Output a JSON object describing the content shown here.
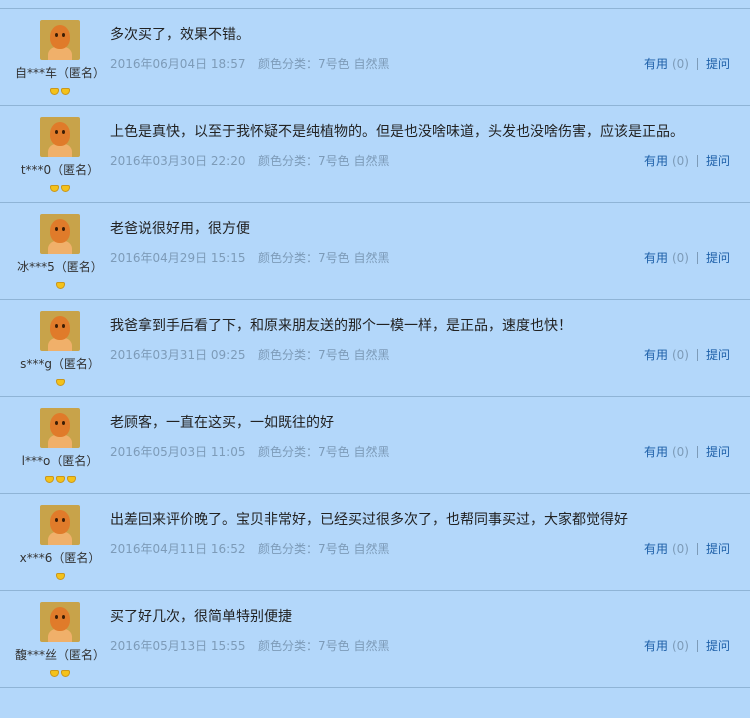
{
  "reviews": [
    {
      "user": "自***车（匿名）",
      "gems": 2,
      "content": "多次买了，效果不错。",
      "date": "2016年06月04日 18:57",
      "spec": "颜色分类：7号色 自然黑",
      "useful_label": "有用",
      "useful_count": "(0)",
      "ask_label": "提问"
    },
    {
      "user": "t***0（匿名）",
      "gems": 2,
      "content": "上色是真快，以至于我怀疑不是纯植物的。但是也没啥味道，头发也没啥伤害，应该是正品。",
      "date": "2016年03月30日 22:20",
      "spec": "颜色分类：7号色 自然黑",
      "useful_label": "有用",
      "useful_count": "(0)",
      "ask_label": "提问"
    },
    {
      "user": "冰***5（匿名）",
      "gems": 1,
      "content": "老爸说很好用，很方便",
      "date": "2016年04月29日 15:15",
      "spec": "颜色分类：7号色 自然黑",
      "useful_label": "有用",
      "useful_count": "(0)",
      "ask_label": "提问"
    },
    {
      "user": "s***g（匿名）",
      "gems": 1,
      "content": "我爸拿到手后看了下，和原来朋友送的那个一模一样，是正品，速度也快！",
      "date": "2016年03月31日 09:25",
      "spec": "颜色分类：7号色 自然黑",
      "useful_label": "有用",
      "useful_count": "(0)",
      "ask_label": "提问"
    },
    {
      "user": "l***o（匿名）",
      "gems": 3,
      "content": "老顾客，一直在这买，一如既往的好",
      "date": "2016年05月03日 11:05",
      "spec": "颜色分类：7号色 自然黑",
      "useful_label": "有用",
      "useful_count": "(0)",
      "ask_label": "提问"
    },
    {
      "user": "x***6（匿名）",
      "gems": 1,
      "content": "出差回来评价晚了。宝贝非常好，已经买过很多次了，也帮同事买过，大家都觉得好",
      "date": "2016年04月11日 16:52",
      "spec": "颜色分类：7号色 自然黑",
      "useful_label": "有用",
      "useful_count": "(0)",
      "ask_label": "提问"
    },
    {
      "user": "馥***丝（匿名）",
      "gems": 2,
      "content": "买了好几次，很简单特别便捷",
      "date": "2016年05月13日 15:55",
      "spec": "颜色分类：7号色 自然黑",
      "useful_label": "有用",
      "useful_count": "(0)",
      "ask_label": "提问"
    }
  ],
  "colors": {
    "background": "#b3d7fa",
    "link": "#1d5fa8",
    "meta": "#7d9bb8",
    "gem": "#f4c21a"
  }
}
